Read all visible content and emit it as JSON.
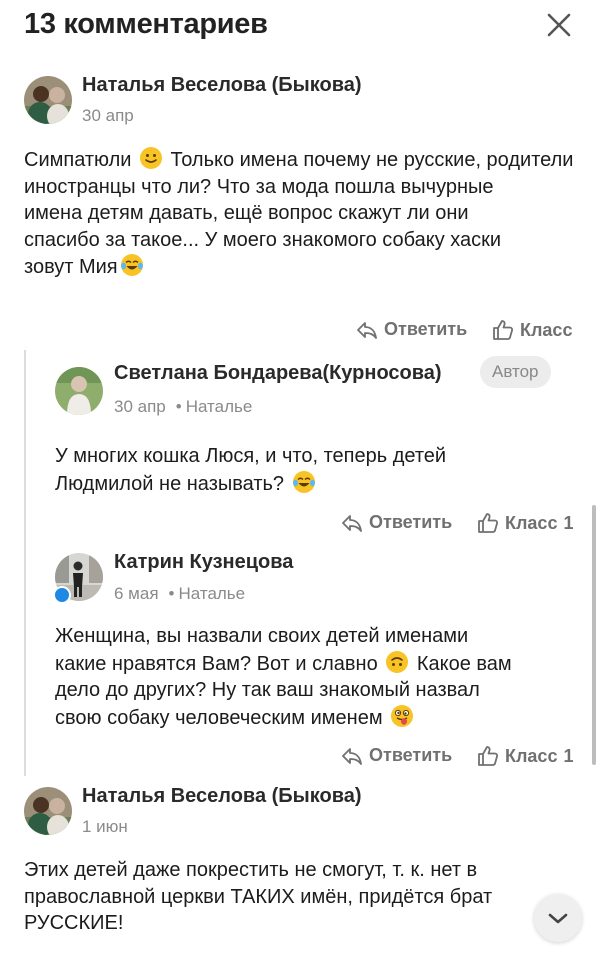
{
  "header": {
    "title": "13 комментариев"
  },
  "comments": [
    {
      "author": "Наталья Веселова (Быкова)",
      "date": "30 апр",
      "text_before": "Симпатюли ",
      "text_after": " Только имена почему не русские, родители",
      "text_lines": [
        "иностранцы что ли? Что за мода пошла вычурные",
        "имена детям давать, ещё вопрос скажут ли они",
        "спасибо за такое... У моего знакомого собаку хаски"
      ],
      "text_last": "зовут Мия",
      "emojis": [
        "slightly-smiling-face",
        "face-with-tears-of-joy"
      ],
      "reply_label": "Ответить",
      "like_label": "Класс"
    },
    {
      "author": "Светлана Бондарева(Курносова)",
      "badge": "Автор",
      "date": "30 апр",
      "reply_to": "Наталье",
      "text_lines": [
        "У многих кошка Люся, и что, теперь детей",
        "Людмилой не называть? "
      ],
      "emojis": [
        "face-with-tears-of-joy"
      ],
      "reply_label": "Ответить",
      "like_label": "Класс",
      "like_count": "1"
    },
    {
      "author": "Катрин Кузнецова",
      "date": "6 мая",
      "reply_to": "Наталье",
      "online": true,
      "text_lines": [
        "Женщина, вы назвали своих детей именами",
        "какие нравятся Вам? Вот и славно ",
        " Какое вам",
        "дело до других? Ну так ваш знакомый назвал",
        "свою собаку человеческим именем "
      ],
      "emojis": [
        "upside-down-face",
        "winking-face-with-tongue"
      ],
      "reply_label": "Ответить",
      "like_label": "Класс",
      "like_count": "1"
    },
    {
      "author": "Наталья Веселова (Быкова)",
      "date": "1 июн",
      "text_lines": [
        "Этих детей даже покрестить не смогут, т. к. нет в",
        "православной церкви ТАКИХ имён, придётся брат",
        "РУССКИЕ!"
      ]
    }
  ],
  "colors": {
    "text": "#1c1c1c",
    "muted": "#8a8a8a",
    "action": "#707070",
    "badge_bg": "#ececec",
    "online": "#1e88e5"
  }
}
